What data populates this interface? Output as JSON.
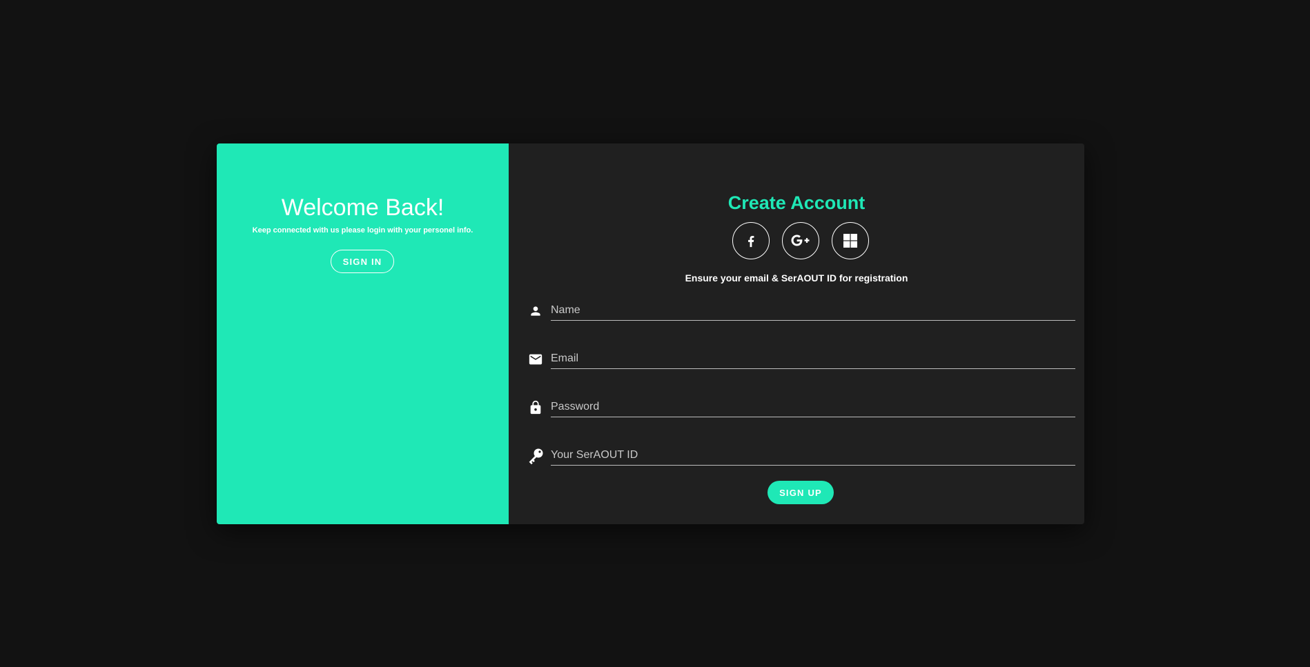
{
  "left_panel": {
    "title": "Welcome Back!",
    "subtitle": "Keep connected with us please login with your personel info.",
    "signin_label": "SIGN IN",
    "background": "#1fe8b6"
  },
  "right_panel": {
    "title": "Create Account",
    "social": [
      {
        "icon": "facebook-icon"
      },
      {
        "icon": "google-plus-icon"
      },
      {
        "icon": "windows-icon"
      }
    ],
    "note": "Ensure your email & SerAOUT ID for registration",
    "fields": {
      "name": {
        "placeholder": "Name",
        "value": "",
        "icon": "person-icon"
      },
      "email": {
        "placeholder": "Email",
        "value": "",
        "icon": "mail-icon"
      },
      "password": {
        "placeholder": "Password",
        "value": "",
        "icon": "lock-icon"
      },
      "seraout_id": {
        "placeholder": "Your SerAOUT ID",
        "value": "",
        "icon": "key-icon"
      }
    },
    "signup_label": "SIGN UP"
  },
  "colors": {
    "accent": "#1fe8b6",
    "page_background": "#121212",
    "card_background": "#202020",
    "text": "#ffffff"
  }
}
